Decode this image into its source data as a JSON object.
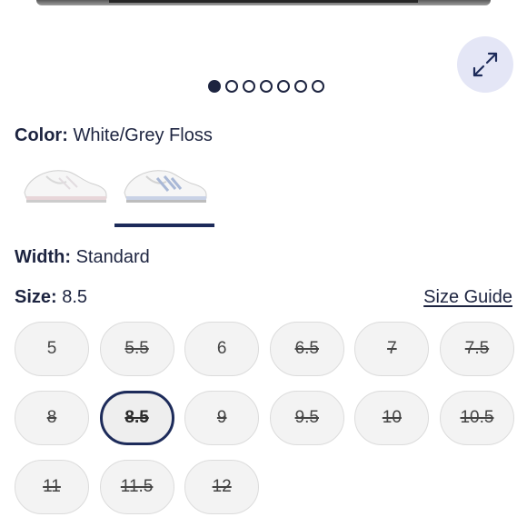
{
  "gallery": {
    "dot_count": 7,
    "active_index": 0
  },
  "color": {
    "label": "Color:",
    "value": "White/Grey Floss"
  },
  "width": {
    "label": "Width:",
    "value": "Standard"
  },
  "size": {
    "label": "Size:",
    "value": "8.5",
    "guide_link": "Size Guide",
    "options": [
      {
        "label": "5",
        "available": true
      },
      {
        "label": "5.5",
        "available": false
      },
      {
        "label": "6",
        "available": true
      },
      {
        "label": "6.5",
        "available": false
      },
      {
        "label": "7",
        "available": false
      },
      {
        "label": "7.5",
        "available": false
      },
      {
        "label": "8",
        "available": false
      },
      {
        "label": "8.5",
        "available": false,
        "selected": true
      },
      {
        "label": "9",
        "available": false
      },
      {
        "label": "9.5",
        "available": false
      },
      {
        "label": "10",
        "available": false
      },
      {
        "label": "10.5",
        "available": false
      },
      {
        "label": "11",
        "available": false
      },
      {
        "label": "11.5",
        "available": false
      },
      {
        "label": "12",
        "available": false
      }
    ]
  },
  "colors": {
    "accent": "#1d2b5a",
    "swatch_bg": "#e4e6f6"
  }
}
